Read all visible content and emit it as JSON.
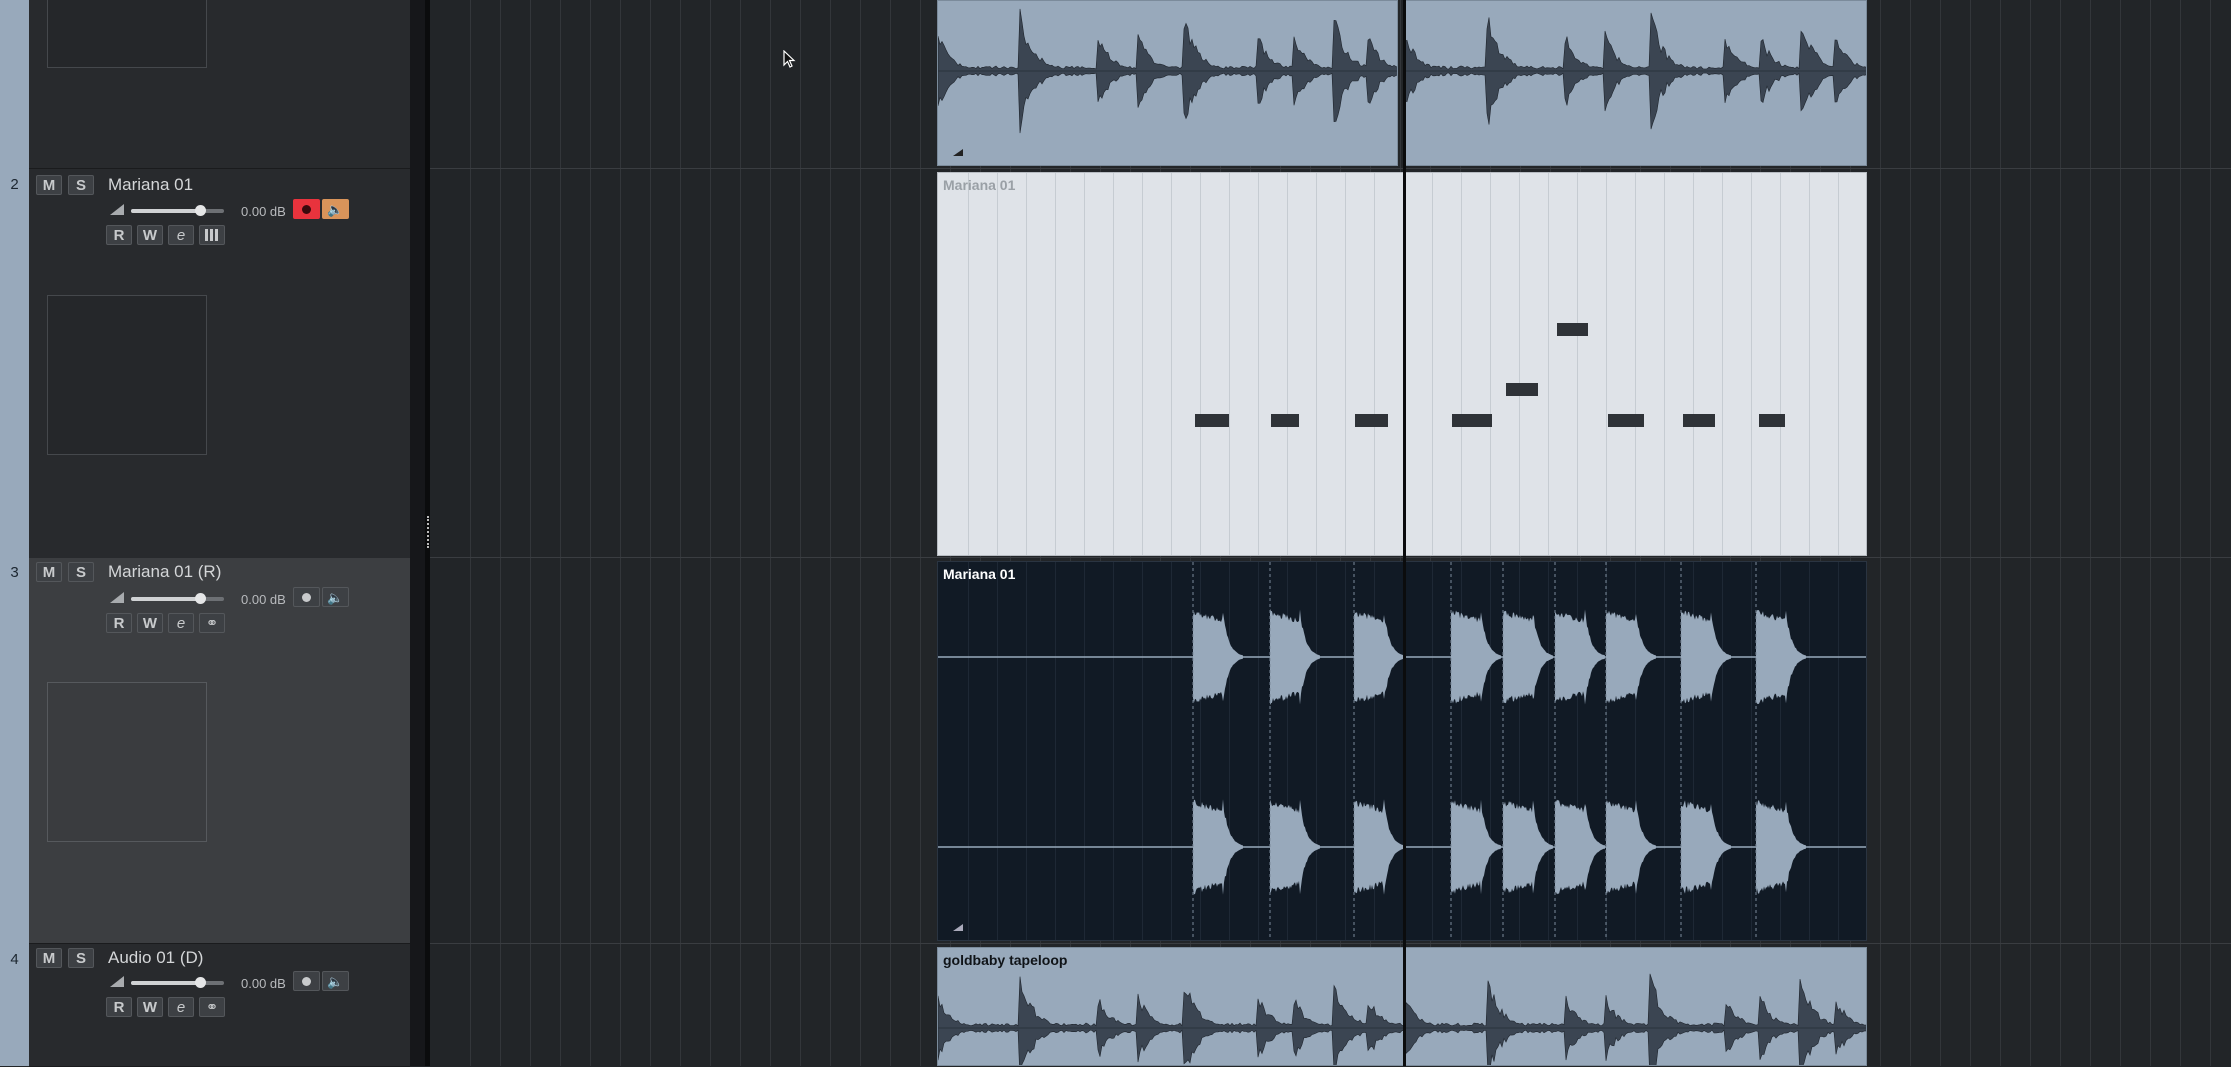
{
  "tracks": [
    {
      "number": "2",
      "name": "Mariana 01",
      "volume": "0.00 dB",
      "buttons": {
        "mute": "M",
        "solo": "S",
        "read": "R",
        "write": "W"
      }
    },
    {
      "number": "3",
      "name": "Mariana 01 (R)",
      "volume": "0.00 dB",
      "buttons": {
        "mute": "M",
        "solo": "S",
        "read": "R",
        "write": "W"
      }
    },
    {
      "number": "4",
      "name": "Audio 01 (D)",
      "volume": "0.00 dB",
      "buttons": {
        "mute": "M",
        "solo": "S",
        "read": "R",
        "write": "W"
      }
    }
  ],
  "events": {
    "midi_part": "Mariana 01",
    "rendered_audio": "Mariana 01",
    "audio_bottom": "goldbaby tapeloop"
  },
  "colors": {
    "audio_event": "#98a9bb",
    "midi_event": "#dfe3e8",
    "dark_event": "#111a25",
    "record_on": "#e8333d",
    "monitor_on": "#d9945a"
  },
  "icons": {
    "volume": "volume-ramp-icon",
    "record": "record-icon",
    "monitor": "speaker-icon",
    "edit": "edit-e-icon",
    "instrument": "piano-keys-icon",
    "link": "link-rings-icon",
    "cursor": "mouse-pointer-icon"
  }
}
